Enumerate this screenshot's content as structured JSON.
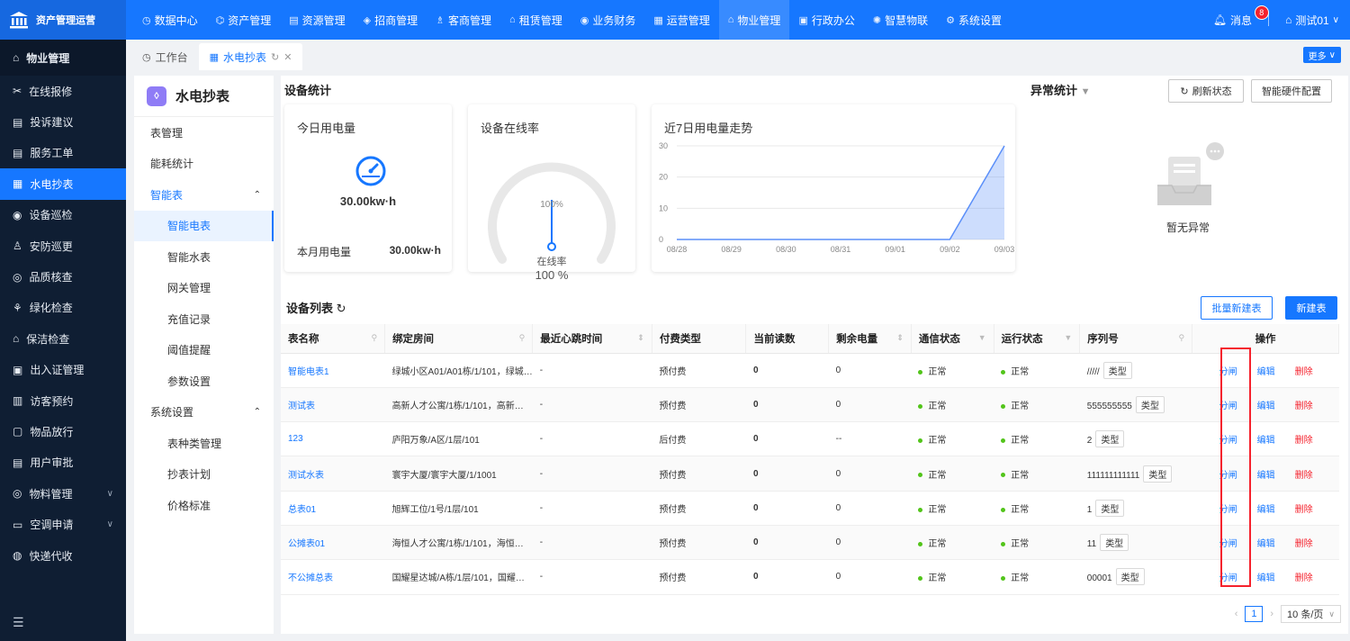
{
  "brand": {
    "title": "资产管理运营"
  },
  "top_nav": [
    {
      "icon": "dashboard-icon",
      "glyph": "◷",
      "label": "数据中心"
    },
    {
      "icon": "asset-icon",
      "glyph": "⌬",
      "label": "资产管理"
    },
    {
      "icon": "resource-icon",
      "glyph": "▤",
      "label": "资源管理"
    },
    {
      "icon": "tag-icon",
      "glyph": "◈",
      "label": "招商管理"
    },
    {
      "icon": "customer-icon",
      "glyph": "♗",
      "label": "客商管理"
    },
    {
      "icon": "lease-icon",
      "glyph": "⌂",
      "label": "租赁管理"
    },
    {
      "icon": "finance-icon",
      "glyph": "◉",
      "label": "业务财务"
    },
    {
      "icon": "operations-icon",
      "glyph": "▦",
      "label": "运营管理"
    },
    {
      "icon": "property-icon",
      "glyph": "⌂",
      "label": "物业管理",
      "active": true
    },
    {
      "icon": "office-icon",
      "glyph": "▣",
      "label": "行政办公"
    },
    {
      "icon": "iot-icon",
      "glyph": "✺",
      "label": "智慧物联"
    },
    {
      "icon": "settings-icon",
      "glyph": "⚙",
      "label": "系统设置"
    }
  ],
  "header_right": {
    "messages_label": "消息",
    "messages_count": "8",
    "user_label": "测试01"
  },
  "sidebar": {
    "header": "物业管理",
    "items": [
      {
        "icon": "repair-icon",
        "glyph": "✂",
        "label": "在线报修"
      },
      {
        "icon": "complaint-icon",
        "glyph": "▤",
        "label": "投诉建议"
      },
      {
        "icon": "work-order-icon",
        "glyph": "▤",
        "label": "服务工单"
      },
      {
        "icon": "meter-icon",
        "glyph": "▦",
        "label": "水电抄表",
        "active": true
      },
      {
        "icon": "inspection-icon",
        "glyph": "◉",
        "label": "设备巡检"
      },
      {
        "icon": "patrol-icon",
        "glyph": "♙",
        "label": "安防巡更"
      },
      {
        "icon": "quality-icon",
        "glyph": "◎",
        "label": "品质核查"
      },
      {
        "icon": "green-icon",
        "glyph": "⚘",
        "label": "绿化检查"
      },
      {
        "icon": "clean-icon",
        "glyph": "⌂",
        "label": "保洁检查"
      },
      {
        "icon": "pass-icon",
        "glyph": "▣",
        "label": "出入证管理"
      },
      {
        "icon": "visitor-icon",
        "glyph": "▥",
        "label": "访客预约"
      },
      {
        "icon": "release-icon",
        "glyph": "▢",
        "label": "物品放行"
      },
      {
        "icon": "audit-icon",
        "glyph": "▤",
        "label": "用户审批"
      },
      {
        "icon": "material-icon",
        "glyph": "◎",
        "label": "物料管理",
        "expandable": true
      },
      {
        "icon": "aircon-icon",
        "glyph": "▭",
        "label": "空调申请",
        "expandable": true
      },
      {
        "icon": "delivery-icon",
        "glyph": "◍",
        "label": "快递代收"
      }
    ]
  },
  "tabs": [
    {
      "icon": "home-icon",
      "glyph": "◷",
      "label": "工作台"
    },
    {
      "icon": "meter-icon",
      "glyph": "▦",
      "label": "水电抄表",
      "active": true
    }
  ],
  "more_label": "更多",
  "subnav": {
    "title": "水电抄表",
    "items": [
      {
        "label": "表管理",
        "type": "item"
      },
      {
        "label": "能耗统计",
        "type": "item"
      },
      {
        "label": "智能表",
        "type": "group",
        "open": true
      },
      {
        "label": "智能电表",
        "type": "sub",
        "active": true
      },
      {
        "label": "智能水表",
        "type": "sub"
      },
      {
        "label": "网关管理",
        "type": "sub"
      },
      {
        "label": "充值记录",
        "type": "sub"
      },
      {
        "label": "阈值提醒",
        "type": "sub"
      },
      {
        "label": "参数设置",
        "type": "sub"
      },
      {
        "label": "系统设置",
        "type": "group"
      },
      {
        "label": "表种类管理",
        "type": "sub"
      },
      {
        "label": "抄表计划",
        "type": "sub"
      },
      {
        "label": "价格标准",
        "type": "sub"
      }
    ]
  },
  "stats": {
    "section_title": "设备统计",
    "today_card": {
      "title": "今日用电量",
      "value": "30.00kw·h",
      "month_label": "本月用电量",
      "month_value": "30.00kw·h"
    },
    "online_card": {
      "title": "设备在线率",
      "gauge_max_label": "100%",
      "gauge_label": "在线率",
      "gauge_value": "100 %",
      "rate": 1.0
    }
  },
  "chart_data": {
    "type": "area",
    "title": "近7日用电量走势",
    "categories": [
      "08/28",
      "08/29",
      "08/30",
      "08/31",
      "09/01",
      "09/02",
      "09/03"
    ],
    "values": [
      0,
      0,
      0,
      0,
      0,
      0,
      30
    ],
    "y_ticks": [
      0,
      10,
      20,
      30
    ],
    "ylim": [
      0,
      30
    ],
    "grid": true,
    "color": "#5b8ff9"
  },
  "anomaly": {
    "title": "异常统计",
    "refresh_label": "刷新状态",
    "config_label": "智能硬件配置",
    "empty_text": "暂无异常"
  },
  "device_list": {
    "title": "设备列表",
    "batch_label": "批量新建表",
    "new_label": "新建表",
    "columns": [
      "表名称",
      "绑定房间",
      "最近心跳时间",
      "付费类型",
      "当前读数",
      "剩余电量",
      "通信状态",
      "运行状态",
      "序列号",
      "操作"
    ],
    "rows": [
      {
        "name": "智能电表1",
        "room": "绿城小区A01/A01栋/1/101，绿城…",
        "heartbeat": "-",
        "pay": "预付费",
        "reading": "0",
        "remain": "0",
        "comm": "正常",
        "run": "正常",
        "serial": "/////",
        "tag": "类型"
      },
      {
        "name": "测试表",
        "room": "高新人才公寓/1栋/1/101，高新…",
        "heartbeat": "-",
        "pay": "预付费",
        "reading": "0",
        "remain": "0",
        "comm": "正常",
        "run": "正常",
        "serial": "555555555",
        "tag": "类型"
      },
      {
        "name": "123",
        "room": "庐阳万象/A区/1层/101",
        "heartbeat": "-",
        "pay": "后付费",
        "reading": "0",
        "remain": "--",
        "comm": "正常",
        "run": "正常",
        "serial": "2",
        "tag": "类型"
      },
      {
        "name": "测试水表",
        "room": "寰宇大厦/寰宇大厦/1/1001",
        "heartbeat": "-",
        "pay": "预付费",
        "reading": "0",
        "remain": "0",
        "comm": "正常",
        "run": "正常",
        "serial": "111111111111",
        "tag": "类型"
      },
      {
        "name": "总表01",
        "room": "旭辉工位/1号/1层/101",
        "heartbeat": "-",
        "pay": "预付费",
        "reading": "0",
        "remain": "0",
        "comm": "正常",
        "run": "正常",
        "serial": "1",
        "tag": "类型"
      },
      {
        "name": "公摊表01",
        "room": "海恒人才公寓/1栋/1/101，海恒…",
        "heartbeat": "-",
        "pay": "预付费",
        "reading": "0",
        "remain": "0",
        "comm": "正常",
        "run": "正常",
        "serial": "11",
        "tag": "类型"
      },
      {
        "name": "不公摊总表",
        "room": "国耀星达城/A栋/1层/101，国耀…",
        "heartbeat": "-",
        "pay": "预付费",
        "reading": "0",
        "remain": "0",
        "comm": "正常",
        "run": "正常",
        "serial": "00001",
        "tag": "类型"
      }
    ],
    "actions": {
      "split": "分闸",
      "edit": "编辑",
      "delete": "删除"
    }
  },
  "pagination": {
    "current": "1",
    "page_size": "10 条/页"
  }
}
